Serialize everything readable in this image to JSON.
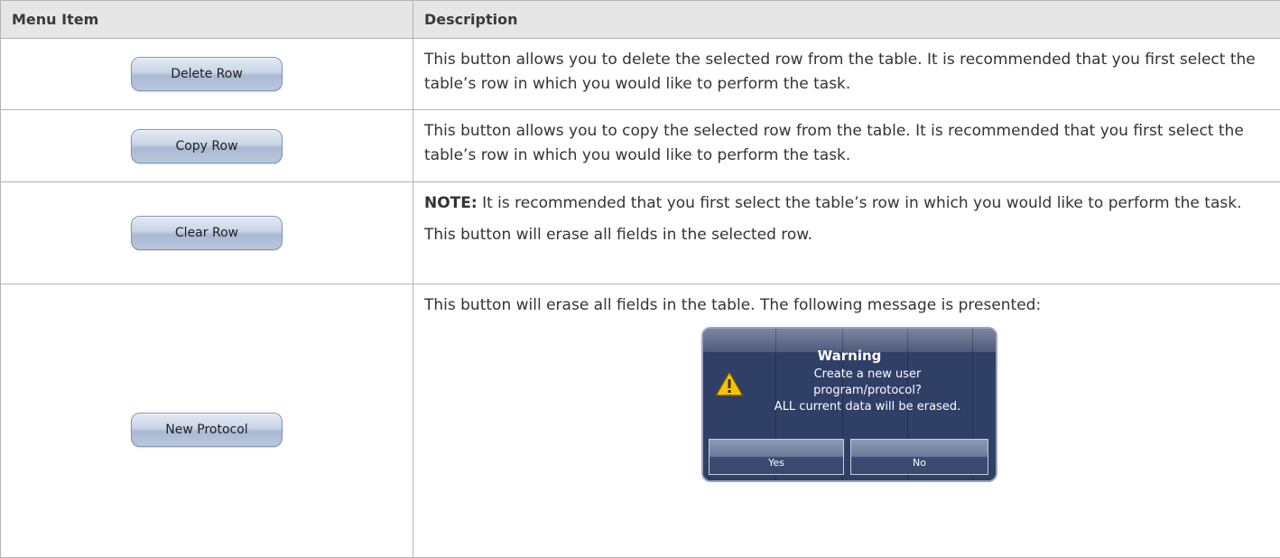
{
  "table": {
    "headers": {
      "menu_item": "Menu Item",
      "description": "Description"
    },
    "rows": [
      {
        "button_label": "Delete Row",
        "description": "This button allows you to delete the selected row from the table. It is recommended that you first select the table’s row in which you would like to perform the task."
      },
      {
        "button_label": "Copy Row",
        "description": "This button allows you to copy the selected row from the table. It is recommended that you first select the table’s row in which you would like to perform the task."
      },
      {
        "button_label": "Clear Row",
        "note_label": "NOTE:",
        "note_text": " It is recommended that you first select the table’s row in which you would like to perform the task.",
        "description": "This button will erase all fields in the selected row."
      },
      {
        "button_label": "New Protocol",
        "description": "This button will erase all fields in the table. The following message is presented:"
      }
    ]
  },
  "warning_dialog": {
    "title": "Warning",
    "message_lines": [
      "Create a new user",
      "program/protocol?",
      "ALL current data will be erased."
    ],
    "yes_label": "Yes",
    "no_label": "No",
    "icon": "warning-triangle-icon"
  },
  "colors": {
    "header_background": "#e6e6e6",
    "border": "#b4b4b4",
    "dialog_background": "#2f3f66",
    "button_blue": "#b9c7dc",
    "warning_yellow": "#f5c400"
  }
}
